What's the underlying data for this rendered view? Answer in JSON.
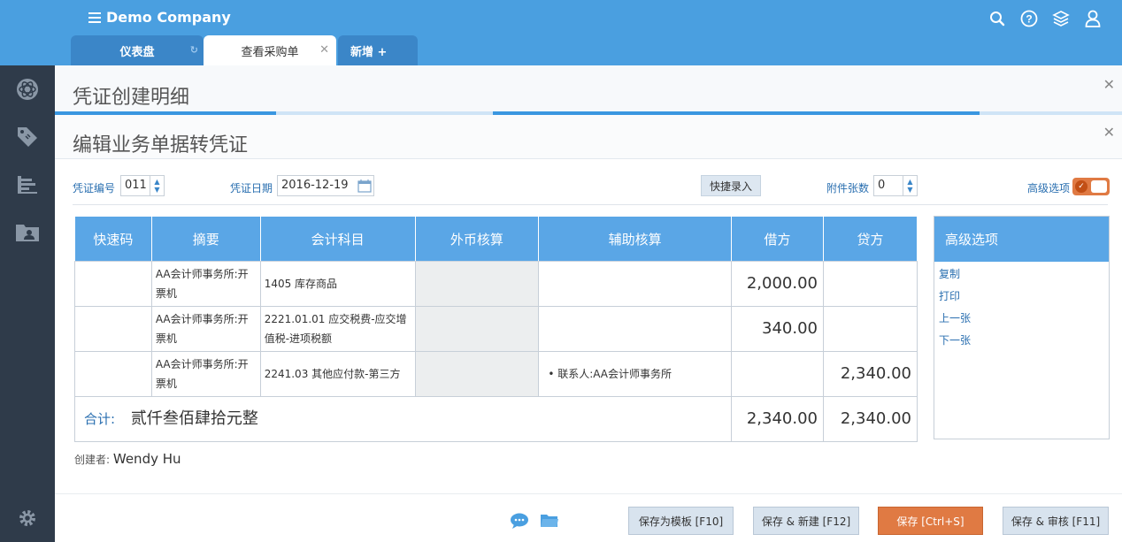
{
  "app": {
    "brand": "Demo Company"
  },
  "tabs": [
    {
      "label": "仪表盘"
    },
    {
      "label": "查看采购单"
    },
    {
      "label": "新增 +"
    }
  ],
  "panels": {
    "detail_title": "凭证创建明细",
    "edit_title": "编辑业务单据转凭证"
  },
  "form": {
    "voucher_no_label": "凭证编号",
    "voucher_no_value": "011",
    "voucher_date_label": "凭证日期",
    "voucher_date_value": "2016-12-19",
    "quick_entry": "快捷录入",
    "attach_label": "附件张数",
    "attach_value": "0",
    "advanced_label": "高级选项"
  },
  "table": {
    "headers": [
      "快速码",
      "摘要",
      "会计科目",
      "外币核算",
      "辅助核算",
      "借方",
      "贷方"
    ],
    "rows": [
      {
        "code": "",
        "summary": "AA会计师事务所:开票机",
        "account": "1405 库存商品",
        "fx": "",
        "aux": "",
        "debit": "2,000.00",
        "credit": ""
      },
      {
        "code": "",
        "summary": "AA会计师事务所:开票机",
        "account": "2221.01.01 应交税费-应交增值税-进项税额",
        "fx": "",
        "aux": "",
        "debit": "340.00",
        "credit": ""
      },
      {
        "code": "",
        "summary": "AA会计师事务所:开票机",
        "account": "2241.03 其他应付款-第三方",
        "fx": "",
        "aux": "联系人:AA会计师事务所",
        "debit": "",
        "credit": "2,340.00"
      }
    ],
    "total_label": "合计:",
    "total_words": "贰仟叁佰肆拾元整",
    "total_debit": "2,340.00",
    "total_credit": "2,340.00"
  },
  "advanced": {
    "title": "高级选项",
    "items": [
      "复制",
      "打印",
      "上一张",
      "下一张"
    ]
  },
  "creator": {
    "label": "创建者:",
    "value": "Wendy Hu"
  },
  "footer": {
    "save_template": "保存为模板 [F10]",
    "save_new": "保存 & 新建 [F12]",
    "save": "保存 [Ctrl+S]",
    "save_review": "保存 & 审核 [F11]"
  },
  "colors": {
    "topbar": "#4a9fe0",
    "sidebar": "#2f3b4a",
    "accent": "#5aa6e6",
    "primary_button": "#e07a43"
  }
}
